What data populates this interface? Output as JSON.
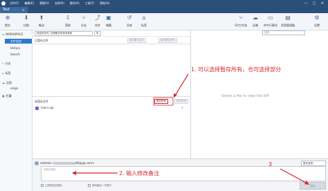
{
  "titlebar": {
    "menus": [
      "文件(F)",
      "编辑(E)",
      "视图(V)",
      "仓库(R)",
      "操作(A)",
      "工具(T)",
      "帮助(H)"
    ],
    "window_controls": [
      "—",
      "□",
      "✕"
    ]
  },
  "tab": {
    "label": "Test",
    "close": "×"
  },
  "toolbar": {
    "items": [
      {
        "label": "提交",
        "icon": "commit-icon"
      },
      {
        "label": "拉取",
        "icon": "pull-icon"
      },
      {
        "label": "推送",
        "icon": "push-icon"
      },
      {
        "label": "获取",
        "icon": "fetch-icon"
      },
      {
        "label": "分支",
        "icon": "branch-icon"
      },
      {
        "label": "合并",
        "icon": "merge-icon"
      },
      {
        "label": "储藏",
        "icon": "stash-icon"
      },
      {
        "label": "丢弃",
        "icon": "discard-icon"
      },
      {
        "label": "标签",
        "icon": "tag-icon"
      },
      {
        "label": "Git工作流",
        "icon": "gitflow-icon"
      },
      {
        "label": "远端",
        "icon": "remote-icon"
      },
      {
        "label": "命令行模式",
        "icon": "terminal-icon"
      },
      {
        "label": "资源管理器",
        "icon": "explorer-icon"
      },
      {
        "label": "设置",
        "icon": "settings-icon"
      }
    ]
  },
  "sidebar": {
    "workspace": "WORKSPACE",
    "items": [
      "文件状态",
      "History",
      "Search"
    ],
    "sections": [
      "分支",
      "标签",
      "远程",
      "origin",
      "贮藏"
    ]
  },
  "filter": {
    "status_select": "待定的文件, 已按照文件状态排序",
    "view_select": "☰"
  },
  "staged": {
    "title": "已暂存文件",
    "unstage_selected": "取消暂存选中",
    "unstage_all": "取消暂存所有"
  },
  "unstaged": {
    "title": "未暂存文件",
    "stage_all": "暂存所有",
    "stage_selected": "暂存所选",
    "files": [
      {
        "name": "main.cpp",
        "action": "+"
      }
    ]
  },
  "diff": {
    "search_placeholder": "搜索",
    "empty_message": "Select a file to view the diff"
  },
  "commit": {
    "user": "sokedev <",
    "email_suffix": "80@qq.com>",
    "options": "提交选项...",
    "placeholder": "初始化项目",
    "push_immediately": "立即推送变更到",
    "amend": "修改最后一次提交",
    "submit": "提交"
  },
  "annotations": {
    "a1": "1. 可以选择暂存所有，也可选择部分",
    "a2": "2. 输入修改备注",
    "a3": "3"
  }
}
